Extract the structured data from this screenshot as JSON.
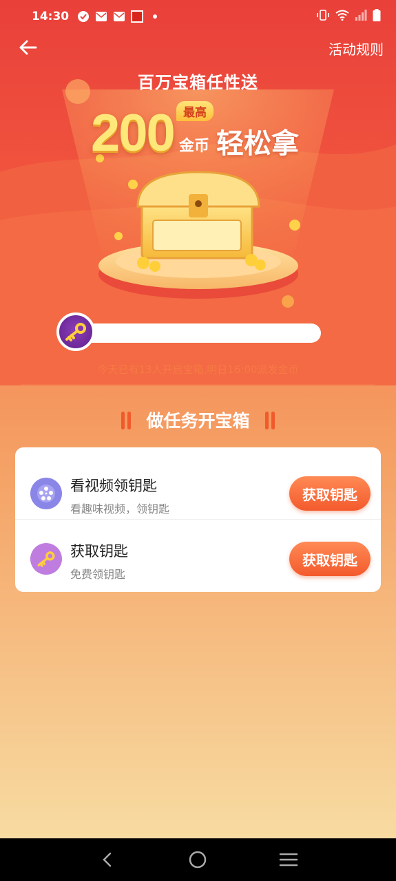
{
  "status_bar": {
    "time": "14:30"
  },
  "header": {
    "rules_label": "活动规则"
  },
  "hero": {
    "headline": "百万宝箱任性送",
    "amount": "200",
    "badge": "最高",
    "unit": "金币",
    "tagline": "轻松拿"
  },
  "progress": {
    "fraction": 0.0,
    "note": "今天已有13人开启宝箱,明日16:00派发金币"
  },
  "section": {
    "title": "做任务开宝箱"
  },
  "tasks": [
    {
      "title": "看视频领钥匙",
      "subtitle": "看趣味视频，领钥匙",
      "button": "获取钥匙",
      "icon": "film-reel-icon"
    },
    {
      "title": "获取钥匙",
      "subtitle": "免费领钥匙",
      "button": "获取钥匙",
      "icon": "key-icon"
    }
  ],
  "colors": {
    "accent": "#f35a2c",
    "header_red": "#e8453a",
    "gold": "#ffe87a"
  }
}
